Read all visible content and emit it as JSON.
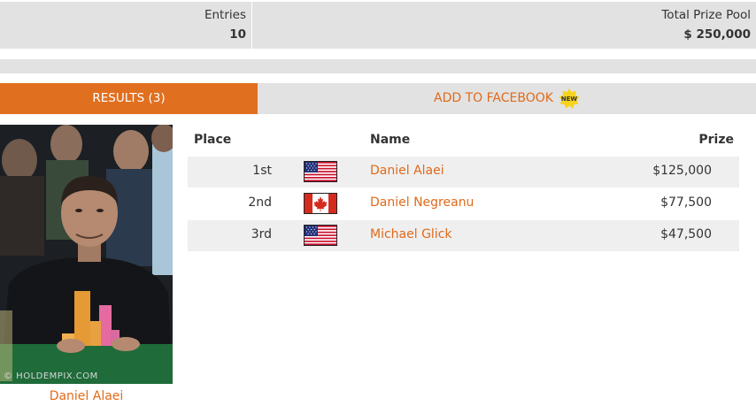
{
  "stats": {
    "entries_label": "Entries",
    "entries_value": "10",
    "prize_pool_label": "Total Prize Pool",
    "prize_pool_value": "$ 250,000"
  },
  "tabs": {
    "results_label": "RESULTS (3)",
    "facebook_label": "ADD TO FACEBOOK",
    "new_badge": "NEW"
  },
  "photo": {
    "watermark": "© HOLDEMPIX.COM",
    "caption": "Daniel Alaei"
  },
  "table": {
    "headers": {
      "place": "Place",
      "name": "Name",
      "prize": "Prize"
    },
    "rows": [
      {
        "place": "1st",
        "flag": "us-flag-icon",
        "name": "Daniel Alaei",
        "prize": "$125,000"
      },
      {
        "place": "2nd",
        "flag": "canada-flag-icon",
        "name": "Daniel Negreanu",
        "prize": "$77,500"
      },
      {
        "place": "3rd",
        "flag": "us-flag-icon",
        "name": "Michael Glick",
        "prize": "$47,500"
      }
    ]
  },
  "colors": {
    "accent": "#e07020",
    "link": "#e06a1a",
    "panel": "#e2e2e2",
    "row_alt": "#efefef"
  }
}
